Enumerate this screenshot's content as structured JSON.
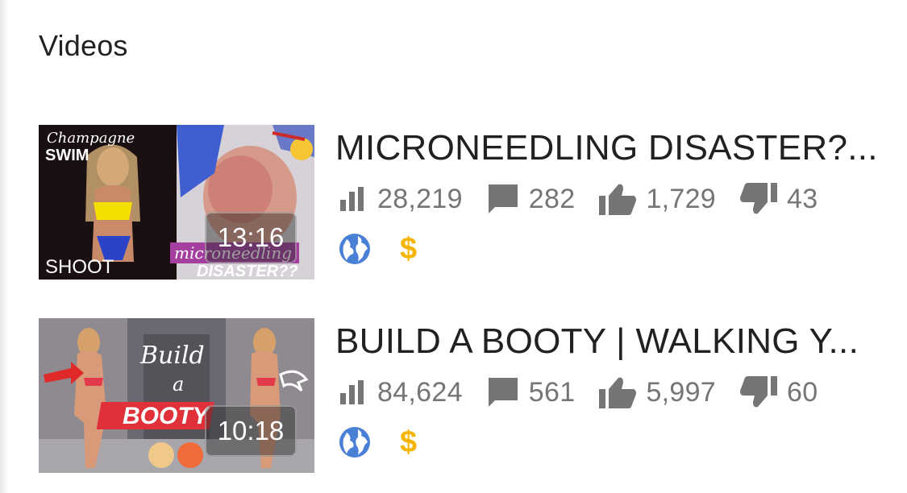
{
  "section": {
    "title": "Videos"
  },
  "colors": {
    "monetization": "#f4b400",
    "public_globe": "#4a7fd6",
    "stat_text": "#757575"
  },
  "videos": [
    {
      "title": "MICRONEEDLING DISASTER?...",
      "duration": "13:16",
      "views": "28,219",
      "comments": "282",
      "likes": "1,729",
      "dislikes": "43",
      "visibility_icon": "globe-icon",
      "monetization_icon": "$",
      "thumb_text": [
        "Champagne",
        "SWIM",
        "SHOOT",
        "microneedling",
        "DISASTER??"
      ]
    },
    {
      "title": "BUILD A BOOTY | WALKING Y...",
      "duration": "10:18",
      "views": "84,624",
      "comments": "561",
      "likes": "5,997",
      "dislikes": "60",
      "visibility_icon": "globe-icon",
      "monetization_icon": "$",
      "thumb_text": [
        "Build",
        "a",
        "BOOTY"
      ]
    }
  ]
}
